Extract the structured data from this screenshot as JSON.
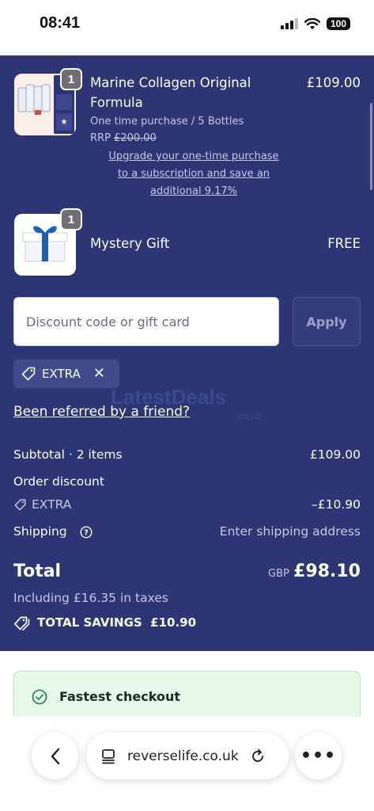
{
  "status_bar": {
    "time": "08:41",
    "battery": "100"
  },
  "cart": {
    "items": [
      {
        "quantity": "1",
        "name_line1": "Marine Collagen Original",
        "name_line2": "Formula",
        "price": "£109.00",
        "purchase_type": "One time purchase / 5 Bottles",
        "rrp_label": "RRP",
        "rrp_value": "£200.00",
        "upgrade_line1": "Upgrade your one-time purchase",
        "upgrade_line2": "to a subscription and save an",
        "upgrade_line3": "additional 9.17%"
      },
      {
        "quantity": "1",
        "name": "Mystery Gift",
        "price": "FREE"
      }
    ]
  },
  "discount": {
    "placeholder": "Discount code or gift card",
    "apply_label": "Apply",
    "applied_code": "EXTRA"
  },
  "referral_link": "Been referred by a friend?",
  "watermark": {
    "text": "LatestDeals",
    "sub": ".co.uk"
  },
  "summary": {
    "subtotal_label": "Subtotal · 2 items",
    "subtotal_value": "£109.00",
    "order_discount_label": "Order discount",
    "discount_code": "EXTRA",
    "discount_value": "–£10.90",
    "shipping_label": "Shipping",
    "shipping_value": "Enter shipping address",
    "total_label": "Total",
    "currency": "GBP",
    "total_value": "£98.10",
    "taxes_note": "Including £16.35 in taxes",
    "savings_label": "TOTAL SAVINGS",
    "savings_value": "£10.90"
  },
  "fastest_checkout": {
    "label": "Fastest checkout"
  },
  "browser": {
    "url": "reverselife.co.uk"
  },
  "colors": {
    "panel": "#2d3575",
    "chip": "#414a8a",
    "fast_checkout_bg": "#e7f7ea",
    "fast_checkout_check": "#2e8b4a"
  },
  "icons": [
    "tag-icon",
    "close-icon",
    "help-circle-icon",
    "check-circle-icon",
    "back-chevron-icon",
    "tabs-icon",
    "reload-icon",
    "more-icon",
    "wifi-icon",
    "signal-icon",
    "battery-icon"
  ]
}
